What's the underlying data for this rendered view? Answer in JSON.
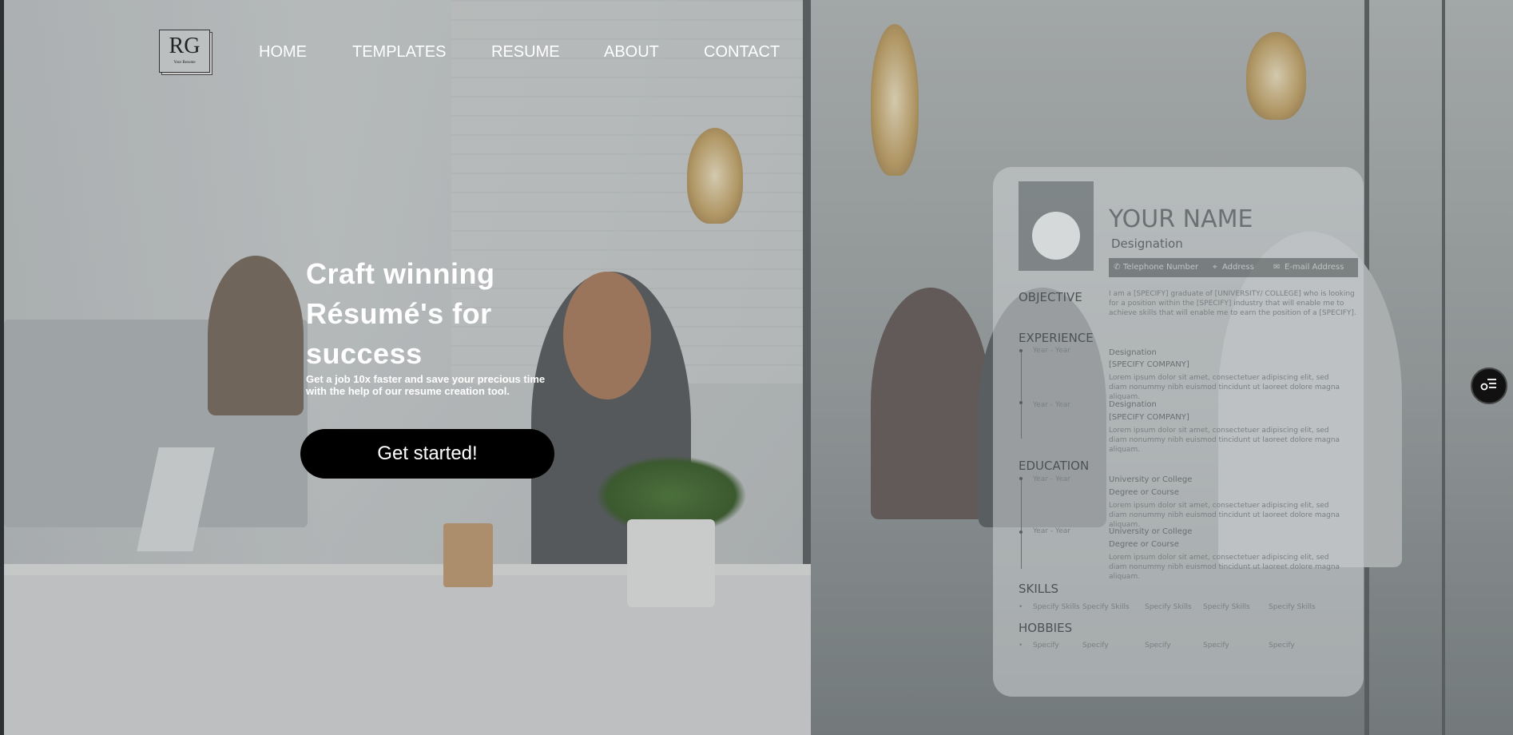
{
  "brand": {
    "logo_text": "RG",
    "logo_subtext": "Your Resume"
  },
  "nav": {
    "items": [
      "HOME",
      "TEMPLATES",
      "RESUME",
      "ABOUT",
      "CONTACT"
    ]
  },
  "hero": {
    "title_lines": [
      "Craft winning",
      "Résumé's for",
      "success"
    ],
    "subtitle": "Get a job 10x faster and save your precious time with the help of our resume creation tool.",
    "cta_label": "Get started!"
  },
  "resume_card": {
    "name": "YOUR NAME",
    "designation": "Designation",
    "contact": {
      "phone": "Telephone Number",
      "address": "Address",
      "email": "E-mail Address"
    },
    "objective": {
      "heading": "OBJECTIVE",
      "text": "I am a [SPECIFY] graduate of [UNIVERSITY/ COLLEGE] who is looking for a position within the [SPECIFY] industry that will enable me to achieve skills that will enable me to earn the position of a [SPECIFY]."
    },
    "experience": {
      "heading": "EXPERIENCE",
      "entries": [
        {
          "years": "Year - Year",
          "role": "Designation",
          "company": "[SPECIFY COMPANY]",
          "desc": "Lorem ipsum dolor sit amet, consectetuer adipiscing elit, sed diam nonummy nibh euismod tincidunt ut laoreet dolore magna aliquam."
        },
        {
          "years": "Year - Year",
          "role": "Designation",
          "company": "[SPECIFY COMPANY]",
          "desc": "Lorem ipsum dolor sit amet, consectetuer adipiscing elit, sed diam nonummy nibh euismod tincidunt ut laoreet dolore magna aliquam."
        }
      ]
    },
    "education": {
      "heading": "EDUCATION",
      "entries": [
        {
          "years": "Year - Year",
          "school": "University or College",
          "degree": "Degree or Course",
          "desc": "Lorem ipsum dolor sit amet, consectetuer adipiscing elit, sed diam nonummy nibh euismod tincidunt ut laoreet dolore magna aliquam."
        },
        {
          "years": "Year - Year",
          "school": "University or College",
          "degree": "Degree or Course",
          "desc": "Lorem ipsum dolor sit amet, consectetuer adipiscing elit, sed diam nonummy nibh euismod tincidunt ut laoreet dolore magna aliquam."
        }
      ]
    },
    "skills": {
      "heading": "SKILLS",
      "items": [
        "Specify Skills",
        "Specify Skills",
        "Specify Skills",
        "Specify Skills",
        "Specify Skills"
      ]
    },
    "hobbies": {
      "heading": "HOBBIES",
      "items": [
        "Specify",
        "Specify",
        "Specify",
        "Specify",
        "Specify"
      ]
    }
  },
  "side_button": {
    "icon": "settings-list-icon"
  }
}
